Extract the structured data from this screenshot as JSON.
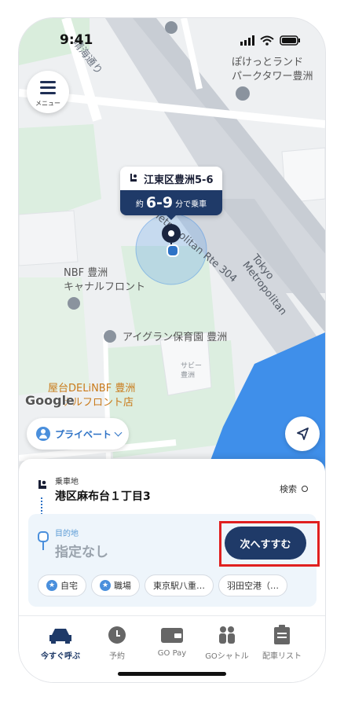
{
  "status_bar": {
    "time": "9:41"
  },
  "menu": {
    "label": "メニュー"
  },
  "map": {
    "road_label_1": "晴海通り",
    "road_label_2": "Metropolitan Rte 304",
    "road_label_3": "Tokyo Metropolitan",
    "poi_parktower": [
      "ぽけっとランド",
      "パークタワー豊洲"
    ],
    "poi_nbf": [
      "NBF 豊洲",
      "キャナルフロント"
    ],
    "poi_aigran": "アイグラン保育園 豊洲",
    "poi_sub": "サビー豊洲",
    "poi_yatai": [
      "屋台DELiNBF 豊洲",
      "ナルフロント店"
    ],
    "google_logo": "Google"
  },
  "pickup_pin": {
    "address": "江東区豊洲5-6",
    "eta_prefix": "約",
    "eta_range": "6-9",
    "eta_suffix": "分で乗車"
  },
  "ride_type": {
    "label": "プライベート"
  },
  "sheet": {
    "pickup_label": "乗車地",
    "pickup_value": "港区麻布台１丁目3",
    "search_label": "検索",
    "dest_label": "目的地",
    "dest_value": "指定なし",
    "next_button": "次へすすむ",
    "chips": [
      "自宅",
      "職場",
      "東京駅八重…",
      "羽田空港（…"
    ]
  },
  "tabs": [
    {
      "label": "今すぐ呼ぶ",
      "icon": "car-icon",
      "active": true
    },
    {
      "label": "予約",
      "icon": "clock-icon"
    },
    {
      "label": "GO Pay",
      "icon": "wallet-icon"
    },
    {
      "label": "GOシャトル",
      "icon": "people-icon"
    },
    {
      "label": "配車リスト",
      "icon": "clipboard-icon"
    }
  ],
  "colors": {
    "primary": "#1f3a68",
    "accent": "#2d72c6",
    "highlight": "#e0201f",
    "water": "#3f8fea"
  }
}
